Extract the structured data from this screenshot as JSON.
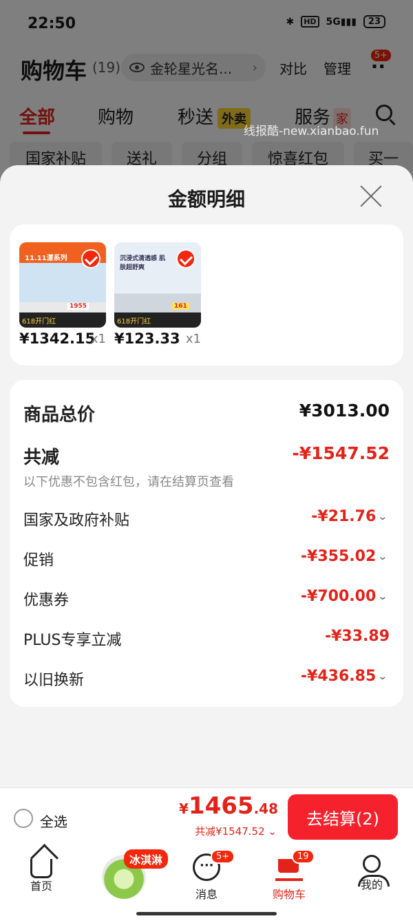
{
  "status_bar": {
    "time": "22:50",
    "network": "5G",
    "hd": "HD",
    "battery": "23"
  },
  "header": {
    "title": "购物车",
    "count": "(19)",
    "store_search": "金轮星光名...",
    "compare": "对比",
    "manage": "管理",
    "more_badge": "5+"
  },
  "categories": {
    "all": "全部",
    "shopping": "购物",
    "express": "秒送",
    "waimai": "外卖",
    "service": "服务",
    "home_tag": "家"
  },
  "watermark": "线报酷-new.xianbao.fun",
  "filters": [
    "国家补贴",
    "送礼",
    "分组",
    "惊喜红包",
    "买一"
  ],
  "sheet": {
    "title": "金额明细",
    "products": [
      {
        "price": "¥1342.15",
        "qty": "x1",
        "banner": "11.11漾系列",
        "sale": "618开门红",
        "price_tag": "1955"
      },
      {
        "price": "¥123.33",
        "qty": "x1",
        "banner": "沉浸式清透感 肌肤超舒爽",
        "sale": "618开门红",
        "price_tag": "161"
      }
    ],
    "total_label": "商品总价",
    "total_value": "¥3013.00",
    "reduce_label": "共减",
    "reduce_value": "-¥1547.52",
    "reduce_note": "以下优惠不包含红包，请在结算页查看",
    "items": [
      {
        "label": "国家及政府补贴",
        "value": "-¥21.76",
        "has_chevron": true
      },
      {
        "label": "促销",
        "value": "-¥355.02",
        "has_chevron": true
      },
      {
        "label": "优惠券",
        "value": "-¥700.00",
        "has_chevron": true
      },
      {
        "label": "PLUS专享立减",
        "value": "-¥33.89",
        "has_chevron": false
      },
      {
        "label": "以旧换新",
        "value": "-¥436.85",
        "has_chevron": true
      }
    ]
  },
  "checkout": {
    "select_all": "全选",
    "currency": "¥",
    "price_int": "1465",
    "price_dec": ".48",
    "discount": "共减¥1547.52",
    "button": "去结算(2)"
  },
  "tabbar": {
    "home": "首页",
    "promo": "冰淇淋",
    "messages": "消息",
    "messages_badge": "5+",
    "cart": "购物车",
    "cart_badge": "19",
    "me": "我的"
  },
  "colors": {
    "accent": "#e2231a",
    "button": "#f5222d"
  }
}
